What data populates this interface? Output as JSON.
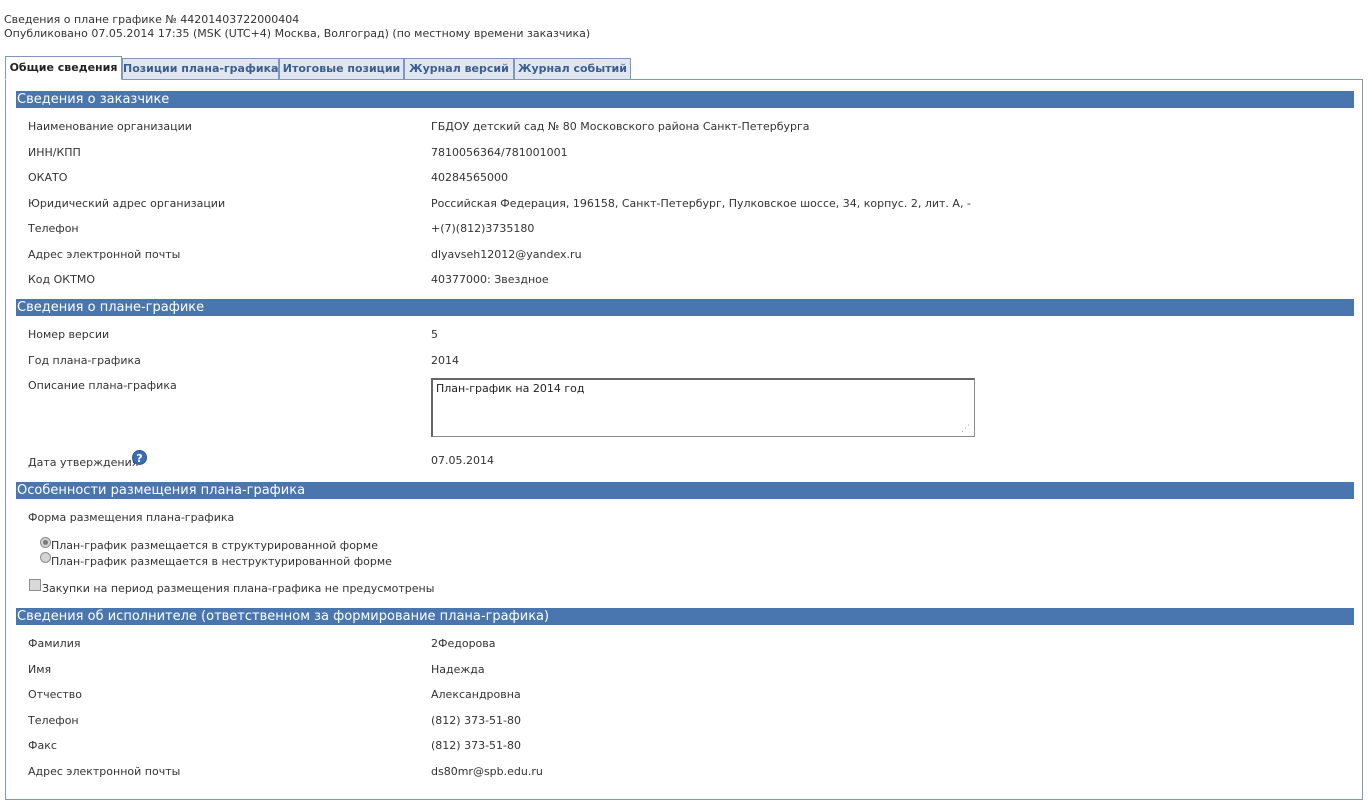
{
  "header": {
    "title": "Сведения о плане графике № 44201403722000404",
    "published": "Опубликовано 07.05.2014 17:35 (MSK (UTC+4) Москва, Волгоград) (по местному времени заказчика)"
  },
  "tabs": [
    {
      "label": "Общие сведения"
    },
    {
      "label": "Позиции плана-графика"
    },
    {
      "label": "Итоговые позиции"
    },
    {
      "label": "Журнал версий"
    },
    {
      "label": "Журнал событий"
    }
  ],
  "customer": {
    "section_title": "Сведения о заказчике",
    "rows": [
      {
        "label": "Наименование организации",
        "value": "ГБДОУ детский сад № 80 Московского района Санкт-Петербурга"
      },
      {
        "label": "ИНН/КПП",
        "value": "7810056364/781001001"
      },
      {
        "label": "ОКАТО",
        "value": "40284565000"
      },
      {
        "label": "Юридический адрес организации",
        "value": "Российская Федерация, 196158, Санкт-Петербург, Пулковское шоссе, 34, корпус. 2, лит. А, -"
      },
      {
        "label": "Телефон",
        "value": "+(7)(812)3735180"
      },
      {
        "label": "Адрес электронной почты",
        "value": "dlyavseh12012@yandex.ru"
      },
      {
        "label": "Код ОКТМО",
        "value": "40377000: Звездное"
      }
    ]
  },
  "plan": {
    "section_title": "Сведения о плане-графике",
    "version_label": "Номер версии",
    "version_value": "5",
    "year_label": "Год плана-графика",
    "year_value": "2014",
    "description_label": "Описание плана-графика",
    "description_value": "План-график на 2014 год",
    "approval_label": "Дата утверждения",
    "approval_value": "07.05.2014"
  },
  "placement": {
    "section_title": "Особенности размещения плана-графика",
    "form_label": "Форма размещения плана-графика",
    "option_structured": "План-график размещается в структурированной форме",
    "option_unstructured": "План-график размещается в неструктурированной форме",
    "selected": "structured",
    "no_purchases_label": "Закупки на период размещения плана-графика не предусмотрены",
    "no_purchases_checked": false
  },
  "executor": {
    "section_title": "Сведения об исполнителе (ответственном за формирование плана-графика)",
    "rows": [
      {
        "label": "Фамилия",
        "value": "2Федорова"
      },
      {
        "label": "Имя",
        "value": "Надежда"
      },
      {
        "label": "Отчество",
        "value": "Александровна"
      },
      {
        "label": "Телефон",
        "value": "(812) 373-51-80"
      },
      {
        "label": "Факс",
        "value": "(812) 373-51-80"
      },
      {
        "label": "Адрес электронной почты",
        "value": "ds80mr@spb.edu.ru"
      }
    ]
  }
}
